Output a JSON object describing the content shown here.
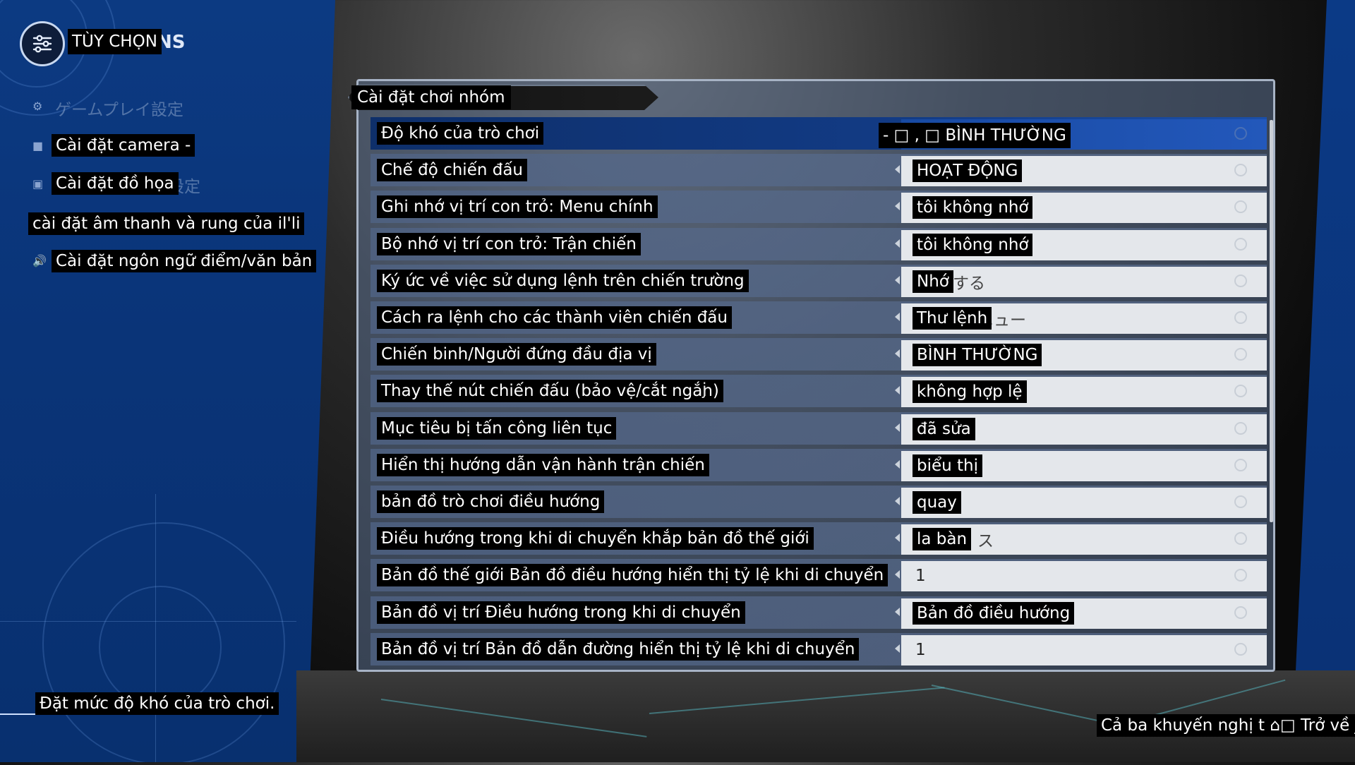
{
  "header": {
    "title": "TÙY CHỌN",
    "title_overflow": "NS"
  },
  "sidebar": {
    "items": [
      {
        "label": "ゲームプレイ設定",
        "state": "ghost"
      },
      {
        "label": "Cài đặt camera -"
      },
      {
        "label": "Cài đặt đồ họa",
        "overflow": "設定"
      },
      {
        "label": "cài đặt âm thanh và rung của il'li"
      },
      {
        "label": "Cài đặt ngôn ngữ điểm/văn bản"
      }
    ]
  },
  "main": {
    "group_title": "Cài đặt chơi nhóm",
    "rows": [
      {
        "label": "Độ khó của trò chơi",
        "value": "- □ , □ BÌNH THƯỜNG",
        "selected": true
      },
      {
        "label": "Chế độ chiến đấu",
        "value": "HOẠT ĐỘNG"
      },
      {
        "label": "Ghi nhớ vị trí con trỏ: Menu chính",
        "value": "tôi không nhớ"
      },
      {
        "label": "Bộ nhớ vị trí con trỏ: Trận chiến",
        "value": "tôi không nhớ"
      },
      {
        "label": "Ký ức về việc sử dụng lệnh trên chiến trường",
        "value": "Nhớ",
        "value_overflow": "する"
      },
      {
        "label": "Cách ra lệnh cho các thành viên chiến đấu",
        "value": "Thư lệnh",
        "value_overflow": "ニュー"
      },
      {
        "label": "Chiến binh/Người đứng đầu địa vị",
        "value": "BÌNH THƯỜNG"
      },
      {
        "label": "Thay thế nút chiến đấu (bảo vệ/cắt ngắn)",
        "label_overflow": "j",
        "value": "không hợp lệ"
      },
      {
        "label": "Mục tiêu bị tấn công liên tục",
        "value": "đã sửa"
      },
      {
        "label": "Hiển thị hướng dẫn vận hành trận chiến",
        "value": "biểu thị"
      },
      {
        "label": "bản đồ trò chơi điều hướng",
        "value": "quay"
      },
      {
        "label": "Điều hướng trong khi di chuyển khắp bản đồ thế giới",
        "value": "la bàn",
        "value_overflow": "ス"
      },
      {
        "label": "Bản đồ thế giới Bản đồ điều hướng hiển thị tỷ lệ khi di chuyển",
        "value": "1",
        "plain": true
      },
      {
        "label": "Bản đồ vị trí Điều hướng trong khi di chuyển",
        "value": "Bản đồ điều hướng"
      },
      {
        "label": "Bản đồ vị trí Bản đồ dẫn đường hiển thị tỷ lệ khi di chuyển",
        "value": "1",
        "plain": true
      }
    ]
  },
  "footer": {
    "description": "Đặt mức độ khó của trò chơi.",
    "hint": "Cả ba khuyến nghị t ⌂□ Trở về juả"
  },
  "colors": {
    "selected_row": "#123b85",
    "sidebar_bg": "#0a3478",
    "value_bg": "#e4e7eb"
  }
}
